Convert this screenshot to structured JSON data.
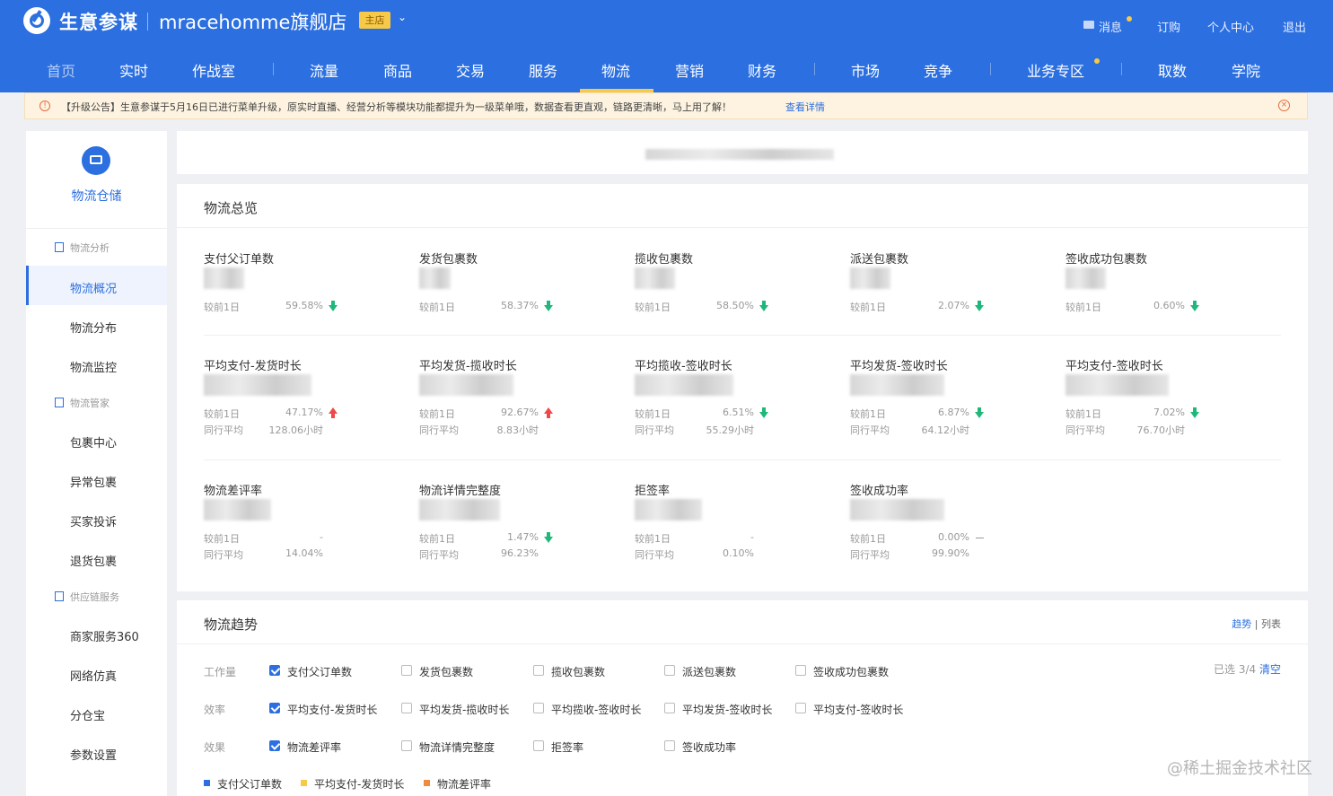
{
  "header": {
    "brand": "生意参谋",
    "shop_name": "mracehomme旗舰店",
    "shop_badge": "主店",
    "links": [
      "消息",
      "订购",
      "个人中心",
      "退出"
    ],
    "nav": [
      "首页",
      "实时",
      "作战室",
      "流量",
      "商品",
      "交易",
      "服务",
      "物流",
      "营销",
      "财务",
      "市场",
      "竞争",
      "业务专区",
      "取数",
      "学院"
    ],
    "active_nav": "物流",
    "colors": {
      "primary": "#2b6fe0",
      "accent": "#f7c948"
    }
  },
  "notice": {
    "text": "【升级公告】生意参谋于5月16日已进行菜单升级，原实时直播、经营分析等模块功能都提升为一级菜单哦，数据查看更直观，链路更清晰，马上用了解！",
    "link": "查看详情"
  },
  "sidebar": {
    "title": "物流仓储",
    "groups": [
      {
        "label": "物流分析",
        "items": [
          "物流概况",
          "物流分布",
          "物流监控"
        ]
      },
      {
        "label": "物流管家",
        "items": [
          "包裹中心",
          "异常包裹",
          "买家投诉",
          "退货包裹"
        ]
      },
      {
        "label": "供应链服务",
        "items": [
          "商家服务360",
          "网络仿真",
          "分仓宝",
          "参数设置"
        ]
      }
    ],
    "active_item": "物流概况"
  },
  "overview": {
    "title": "物流总览",
    "compare_label": "较前1日",
    "peer_label": "同行平均",
    "metrics": [
      {
        "name": "支付父订单数",
        "change": "59.58%",
        "trend": "down"
      },
      {
        "name": "发货包裹数",
        "change": "58.37%",
        "trend": "down"
      },
      {
        "name": "揽收包裹数",
        "change": "58.50%",
        "trend": "down"
      },
      {
        "name": "派送包裹数",
        "change": "2.07%",
        "trend": "down"
      },
      {
        "name": "签收成功包裹数",
        "change": "0.60%",
        "trend": "down"
      },
      {
        "name": "平均支付-发货时长",
        "change": "47.17%",
        "trend": "up",
        "peer": "128.06小时"
      },
      {
        "name": "平均发货-揽收时长",
        "change": "92.67%",
        "trend": "up",
        "peer": "8.83小时"
      },
      {
        "name": "平均揽收-签收时长",
        "change": "6.51%",
        "trend": "down",
        "peer": "55.29小时"
      },
      {
        "name": "平均发货-签收时长",
        "change": "6.87%",
        "trend": "down",
        "peer": "64.12小时"
      },
      {
        "name": "平均支付-签收时长",
        "change": "7.02%",
        "trend": "down",
        "peer": "76.70小时"
      },
      {
        "name": "物流差评率",
        "change": "-",
        "trend": "none",
        "peer": "14.04%"
      },
      {
        "name": "物流详情完整度",
        "change": "1.47%",
        "trend": "down",
        "peer": "96.23%"
      },
      {
        "name": "拒签率",
        "change": "-",
        "trend": "none",
        "peer": "0.10%"
      },
      {
        "name": "签收成功率",
        "change": "0.00%",
        "trend": "flat",
        "peer": "99.90%"
      }
    ]
  },
  "trend": {
    "title": "物流趋势",
    "tab_trend": "趋势",
    "tab_sep": "|",
    "tab_list": "列表",
    "selected_text": "已选 3/4",
    "clear": "清空",
    "rows": [
      {
        "label": "工作量",
        "options": [
          {
            "text": "支付父订单数",
            "checked": true
          },
          {
            "text": "发货包裹数",
            "checked": false
          },
          {
            "text": "揽收包裹数",
            "checked": false
          },
          {
            "text": "派送包裹数",
            "checked": false
          },
          {
            "text": "签收成功包裹数",
            "checked": false
          }
        ]
      },
      {
        "label": "效率",
        "options": [
          {
            "text": "平均支付-发货时长",
            "checked": true
          },
          {
            "text": "平均发货-揽收时长",
            "checked": false
          },
          {
            "text": "平均揽收-签收时长",
            "checked": false
          },
          {
            "text": "平均发货-签收时长",
            "checked": false
          },
          {
            "text": "平均支付-签收时长",
            "checked": false
          }
        ]
      },
      {
        "label": "效果",
        "options": [
          {
            "text": "物流差评率",
            "checked": true
          },
          {
            "text": "物流详情完整度",
            "checked": false
          },
          {
            "text": "拒签率",
            "checked": false
          },
          {
            "text": "签收成功率",
            "checked": false
          }
        ]
      }
    ],
    "legend": [
      {
        "text": "支付父订单数",
        "color": "#2b6fe0"
      },
      {
        "text": "平均支付-发货时长",
        "color": "#f7c948"
      },
      {
        "text": "物流差评率",
        "color": "#f08a3c"
      }
    ]
  },
  "watermark": "@稀土掘金技术社区"
}
